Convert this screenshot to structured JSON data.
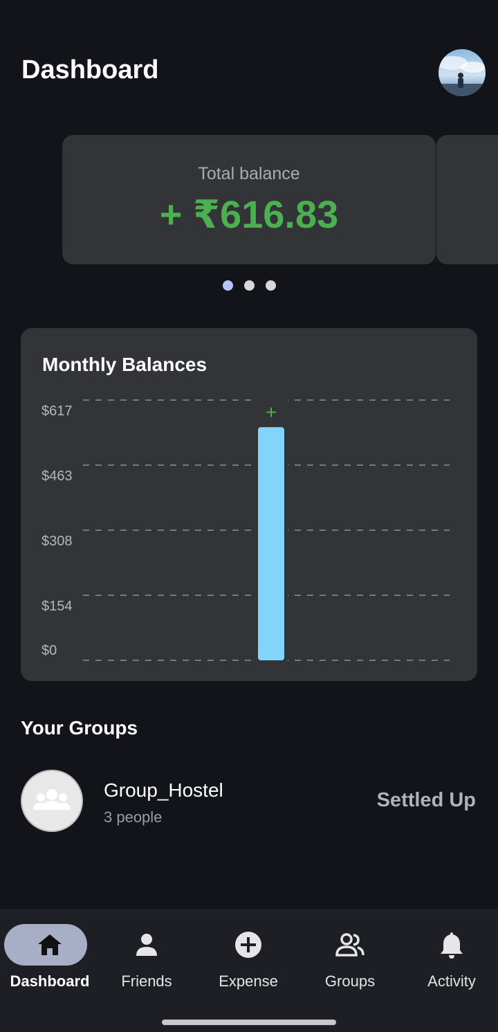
{
  "header": {
    "title": "Dashboard"
  },
  "balance": {
    "label": "Total balance",
    "amount": "+ ₹616.83"
  },
  "carousel": {
    "page_count": 3,
    "active_index": 0
  },
  "chart_data": {
    "type": "bar",
    "title": "Monthly Balances",
    "y_ticks": [
      "$617",
      "$463",
      "$308",
      "$154",
      "$0"
    ],
    "ylim": [
      0,
      617
    ],
    "categories": [
      ""
    ],
    "values": [
      616.83
    ],
    "data_labels": [
      "+"
    ],
    "grid": "dashed horizontal",
    "colors": {
      "bar": "#81d4fa",
      "label": "#4caf50"
    }
  },
  "groups": {
    "title": "Your Groups",
    "items": [
      {
        "name": "Group_Hostel",
        "members": "3 people",
        "status": "Settled Up"
      }
    ]
  },
  "nav": {
    "items": [
      {
        "label": "Dashboard",
        "icon": "home-icon",
        "active": true
      },
      {
        "label": "Friends",
        "icon": "person-icon",
        "active": false
      },
      {
        "label": "Expense",
        "icon": "add-circle-icon",
        "active": false
      },
      {
        "label": "Groups",
        "icon": "group-icon",
        "active": false
      },
      {
        "label": "Activity",
        "icon": "bell-icon",
        "active": false
      }
    ]
  },
  "colors": {
    "positive": "#4caf50",
    "accent": "#81d4fa",
    "background": "#13141a",
    "card": "#333438"
  }
}
